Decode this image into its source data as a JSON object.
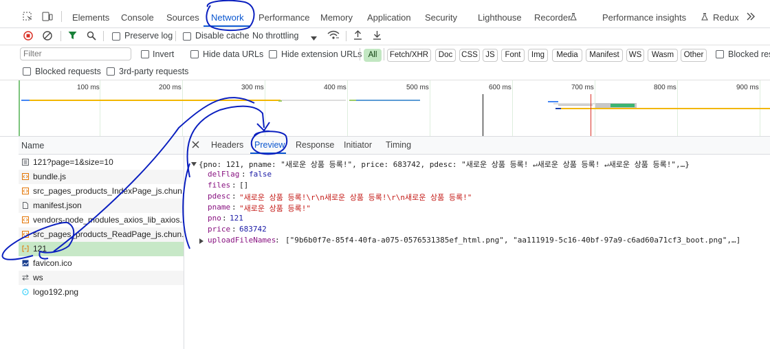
{
  "tabs": [
    "Elements",
    "Console",
    "Sources",
    "Network",
    "Performance",
    "Memory",
    "Application",
    "Security",
    "Lighthouse",
    "Recorder",
    "Performance insights",
    "Redux"
  ],
  "toolbar": {
    "preserve_log": "Preserve log",
    "disable_cache": "Disable cache",
    "throttling": "No throttling"
  },
  "filterbar": {
    "placeholder": "Filter",
    "invert": "Invert",
    "hide_data": "Hide data URLs",
    "hide_ext": "Hide extension URLs",
    "chips": [
      "All",
      "Fetch/XHR",
      "Doc",
      "CSS",
      "JS",
      "Font",
      "Img",
      "Media",
      "Manifest",
      "WS",
      "Wasm",
      "Other"
    ],
    "blocked_res": "Blocked res",
    "blocked_req": "Blocked requests",
    "third_party": "3rd-party requests"
  },
  "overview": {
    "ticks": [
      "100 ms",
      "200 ms",
      "300 ms",
      "400 ms",
      "500 ms",
      "600 ms",
      "700 ms",
      "800 ms",
      "900 ms"
    ]
  },
  "list": {
    "header": "Name",
    "rows": [
      {
        "name": "121?page=1&size=10",
        "icon": "document-icon"
      },
      {
        "name": "bundle.js",
        "icon": "script-icon"
      },
      {
        "name": "src_pages_products_IndexPage_js.chun...",
        "icon": "script-icon"
      },
      {
        "name": "manifest.json",
        "icon": "file-icon"
      },
      {
        "name": "vendors-node_modules_axios_lib_axios...",
        "icon": "script-icon"
      },
      {
        "name": "src_pages_products_ReadPage_js.chun...",
        "icon": "script-icon"
      },
      {
        "name": "121",
        "icon": "fetch-icon"
      },
      {
        "name": "favicon.ico",
        "icon": "image-icon"
      },
      {
        "name": "ws",
        "icon": "websocket-icon"
      },
      {
        "name": "logo192.png",
        "icon": "image-icon"
      }
    ]
  },
  "detail": {
    "tabs": [
      "Headers",
      "Preview",
      "Response",
      "Initiator",
      "Timing"
    ],
    "summary": "{pno: 121, pname: \"새로운 상품 등록!\", price: 683742, pdesc: \"새로운 상품 등록! ↵새로운 상품 등록! ↵새로운 상품 등록!\",…}",
    "lines": [
      {
        "key": "delFlag",
        "value": "false",
        "kind": "n"
      },
      {
        "key": "files",
        "value": "[]",
        "kind": "p"
      },
      {
        "key": "pdesc",
        "value": "\"새로운 상품 등록!\\r\\n새로운 상품 등록!\\r\\n새로운 상품 등록!\"",
        "kind": "s"
      },
      {
        "key": "pname",
        "value": "\"새로운 상품 등록!\"",
        "kind": "s"
      },
      {
        "key": "pno",
        "value": "121",
        "kind": "n"
      },
      {
        "key": "price",
        "value": "683742",
        "kind": "n"
      },
      {
        "key": "uploadFileNames",
        "value": "[\"9b6b0f7e-85f4-40fa-a075-0576531385ef_html.png\", \"aa111919-5c16-40bf-97a9-c6ad60a71cf3_boot.png\",…]",
        "kind": "p"
      }
    ]
  },
  "colors": {
    "accent": "#0b57d0",
    "selected_row": "#c7e8c7",
    "ink": "#0a1fbf"
  }
}
